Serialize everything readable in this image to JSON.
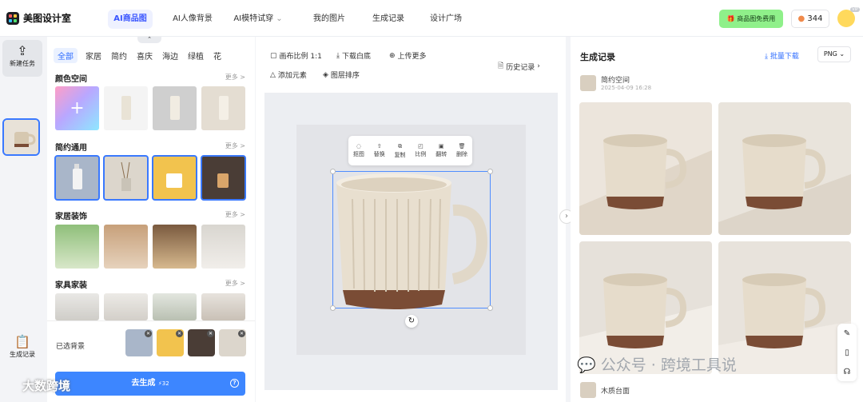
{
  "app": {
    "name": "美图设计室"
  },
  "nav": {
    "tabs": [
      "AI商品图",
      "AI人像背景",
      "AI模特试穿",
      "我的图片",
      "生成记录",
      "设计广场"
    ],
    "promo": "商品图免费用",
    "credits": "344",
    "vip": "VIP"
  },
  "rail": {
    "new_task": "新建任务",
    "history": "生成记录"
  },
  "library": {
    "categories": [
      "全部",
      "家居",
      "简约",
      "喜庆",
      "海边",
      "绿植",
      "花"
    ],
    "more": "更多 >",
    "sections": [
      "颜色空间",
      "简约通用",
      "家居装饰",
      "家具家装"
    ],
    "selected_label": "已选背景",
    "generate": "去生成",
    "generate_cost": "32"
  },
  "canvas": {
    "tools": [
      "画布比例 1:1",
      "下载白底",
      "上传更多",
      "添加元素",
      "图层排序"
    ],
    "history": "历史记录",
    "mini_tools": [
      "抠图",
      "替换",
      "复制",
      "比例",
      "翻转",
      "删除"
    ]
  },
  "history": {
    "title": "生成记录",
    "batch_download": "批量下载",
    "format": "PNG",
    "records": [
      {
        "name": "简约空间",
        "time": "2025-04-09 16:28"
      },
      {
        "name": "木质台面",
        "time": ""
      }
    ]
  },
  "watermark": {
    "main": "公众号 · 跨境工具说",
    "corner": "大数跨境"
  },
  "colors": {
    "accent": "#3a79ff",
    "promo": "#8ff08a"
  }
}
